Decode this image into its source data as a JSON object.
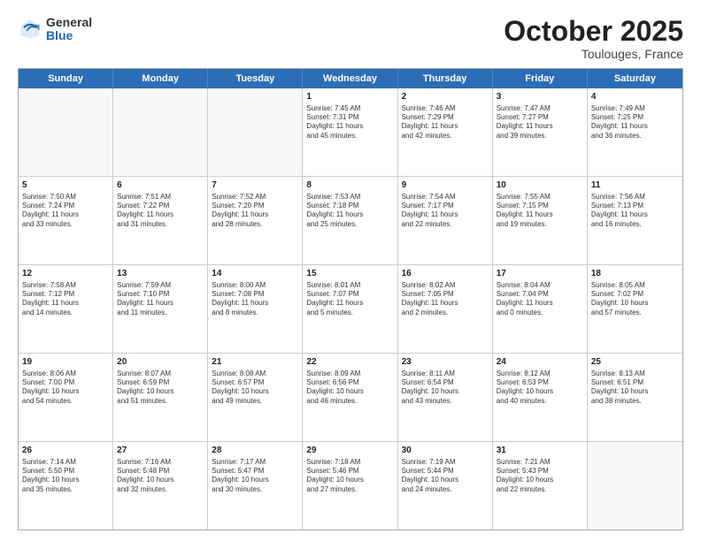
{
  "logo": {
    "general": "General",
    "blue": "Blue"
  },
  "header": {
    "month": "October 2025",
    "location": "Toulouges, France"
  },
  "weekdays": [
    "Sunday",
    "Monday",
    "Tuesday",
    "Wednesday",
    "Thursday",
    "Friday",
    "Saturday"
  ],
  "rows": [
    [
      {
        "day": "",
        "text": "",
        "empty": true
      },
      {
        "day": "",
        "text": "",
        "empty": true
      },
      {
        "day": "",
        "text": "",
        "empty": true
      },
      {
        "day": "1",
        "text": "Sunrise: 7:45 AM\nSunset: 7:31 PM\nDaylight: 11 hours\nand 45 minutes."
      },
      {
        "day": "2",
        "text": "Sunrise: 7:46 AM\nSunset: 7:29 PM\nDaylight: 11 hours\nand 42 minutes."
      },
      {
        "day": "3",
        "text": "Sunrise: 7:47 AM\nSunset: 7:27 PM\nDaylight: 11 hours\nand 39 minutes."
      },
      {
        "day": "4",
        "text": "Sunrise: 7:49 AM\nSunset: 7:25 PM\nDaylight: 11 hours\nand 36 minutes."
      }
    ],
    [
      {
        "day": "5",
        "text": "Sunrise: 7:50 AM\nSunset: 7:24 PM\nDaylight: 11 hours\nand 33 minutes."
      },
      {
        "day": "6",
        "text": "Sunrise: 7:51 AM\nSunset: 7:22 PM\nDaylight: 11 hours\nand 31 minutes."
      },
      {
        "day": "7",
        "text": "Sunrise: 7:52 AM\nSunset: 7:20 PM\nDaylight: 11 hours\nand 28 minutes."
      },
      {
        "day": "8",
        "text": "Sunrise: 7:53 AM\nSunset: 7:18 PM\nDaylight: 11 hours\nand 25 minutes."
      },
      {
        "day": "9",
        "text": "Sunrise: 7:54 AM\nSunset: 7:17 PM\nDaylight: 11 hours\nand 22 minutes."
      },
      {
        "day": "10",
        "text": "Sunrise: 7:55 AM\nSunset: 7:15 PM\nDaylight: 11 hours\nand 19 minutes."
      },
      {
        "day": "11",
        "text": "Sunrise: 7:56 AM\nSunset: 7:13 PM\nDaylight: 11 hours\nand 16 minutes."
      }
    ],
    [
      {
        "day": "12",
        "text": "Sunrise: 7:58 AM\nSunset: 7:12 PM\nDaylight: 11 hours\nand 14 minutes."
      },
      {
        "day": "13",
        "text": "Sunrise: 7:59 AM\nSunset: 7:10 PM\nDaylight: 11 hours\nand 11 minutes."
      },
      {
        "day": "14",
        "text": "Sunrise: 8:00 AM\nSunset: 7:08 PM\nDaylight: 11 hours\nand 8 minutes."
      },
      {
        "day": "15",
        "text": "Sunrise: 8:01 AM\nSunset: 7:07 PM\nDaylight: 11 hours\nand 5 minutes."
      },
      {
        "day": "16",
        "text": "Sunrise: 8:02 AM\nSunset: 7:05 PM\nDaylight: 11 hours\nand 2 minutes."
      },
      {
        "day": "17",
        "text": "Sunrise: 8:04 AM\nSunset: 7:04 PM\nDaylight: 11 hours\nand 0 minutes."
      },
      {
        "day": "18",
        "text": "Sunrise: 8:05 AM\nSunset: 7:02 PM\nDaylight: 10 hours\nand 57 minutes."
      }
    ],
    [
      {
        "day": "19",
        "text": "Sunrise: 8:06 AM\nSunset: 7:00 PM\nDaylight: 10 hours\nand 54 minutes."
      },
      {
        "day": "20",
        "text": "Sunrise: 8:07 AM\nSunset: 6:59 PM\nDaylight: 10 hours\nand 51 minutes."
      },
      {
        "day": "21",
        "text": "Sunrise: 8:08 AM\nSunset: 6:57 PM\nDaylight: 10 hours\nand 49 minutes."
      },
      {
        "day": "22",
        "text": "Sunrise: 8:09 AM\nSunset: 6:56 PM\nDaylight: 10 hours\nand 46 minutes."
      },
      {
        "day": "23",
        "text": "Sunrise: 8:11 AM\nSunset: 6:54 PM\nDaylight: 10 hours\nand 43 minutes."
      },
      {
        "day": "24",
        "text": "Sunrise: 8:12 AM\nSunset: 6:53 PM\nDaylight: 10 hours\nand 40 minutes."
      },
      {
        "day": "25",
        "text": "Sunrise: 8:13 AM\nSunset: 6:51 PM\nDaylight: 10 hours\nand 38 minutes."
      }
    ],
    [
      {
        "day": "26",
        "text": "Sunrise: 7:14 AM\nSunset: 5:50 PM\nDaylight: 10 hours\nand 35 minutes."
      },
      {
        "day": "27",
        "text": "Sunrise: 7:16 AM\nSunset: 5:48 PM\nDaylight: 10 hours\nand 32 minutes."
      },
      {
        "day": "28",
        "text": "Sunrise: 7:17 AM\nSunset: 5:47 PM\nDaylight: 10 hours\nand 30 minutes."
      },
      {
        "day": "29",
        "text": "Sunrise: 7:18 AM\nSunset: 5:46 PM\nDaylight: 10 hours\nand 27 minutes."
      },
      {
        "day": "30",
        "text": "Sunrise: 7:19 AM\nSunset: 5:44 PM\nDaylight: 10 hours\nand 24 minutes."
      },
      {
        "day": "31",
        "text": "Sunrise: 7:21 AM\nSunset: 5:43 PM\nDaylight: 10 hours\nand 22 minutes."
      },
      {
        "day": "",
        "text": "",
        "empty": true
      }
    ]
  ]
}
